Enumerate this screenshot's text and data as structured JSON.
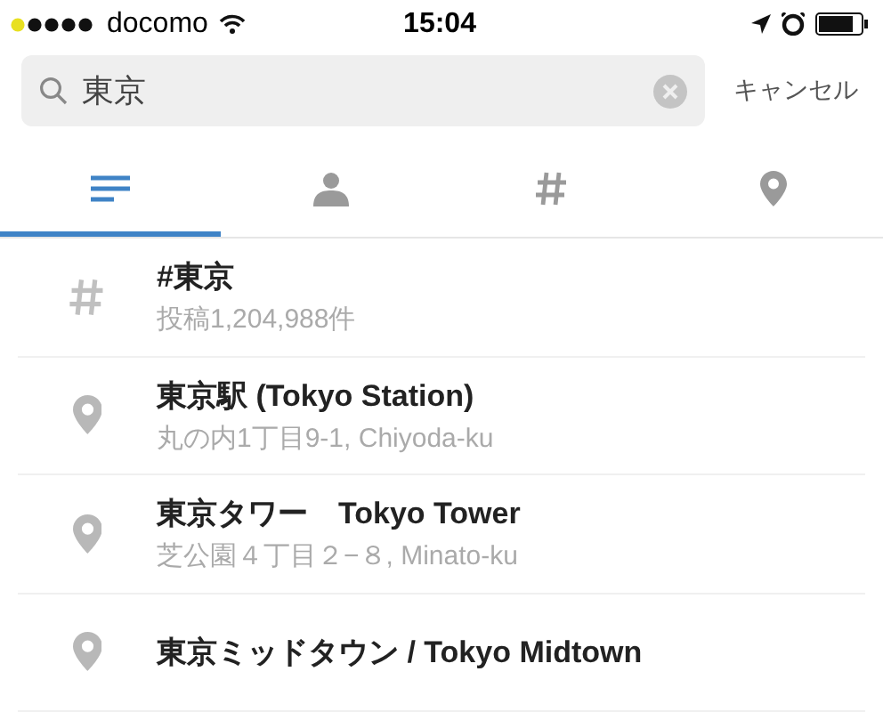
{
  "status_bar": {
    "carrier": "docomo",
    "time": "15:04"
  },
  "search": {
    "value": "東京",
    "cancel": "キャンセル"
  },
  "tabs": [
    {
      "kind": "list",
      "selected": true
    },
    {
      "kind": "person",
      "selected": false
    },
    {
      "kind": "hashtag",
      "selected": false
    },
    {
      "kind": "place",
      "selected": false
    }
  ],
  "results": [
    {
      "kind": "hashtag",
      "title": "#東京",
      "subtitle": "投稿1,204,988件"
    },
    {
      "kind": "place",
      "title": "東京駅 (Tokyo Station)",
      "subtitle": "丸の内1丁目9-1, Chiyoda-ku"
    },
    {
      "kind": "place",
      "title": "東京タワー　Tokyo Tower",
      "subtitle": "芝公園４丁目２−８, Minato-ku"
    },
    {
      "kind": "place",
      "title": "東京ミッドタウン / Tokyo Midtown"
    }
  ]
}
